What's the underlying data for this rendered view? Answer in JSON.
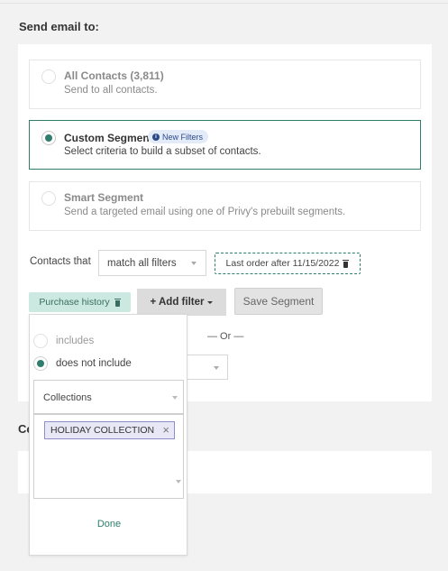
{
  "heading": "Send email to:",
  "options": [
    {
      "title": "All Contacts (3,811)",
      "description": "Send to all contacts.",
      "selected": false
    },
    {
      "title": "Custom Segment",
      "description": "Select criteria to build a subset of contacts.",
      "selected": true,
      "badge": "New Filters"
    },
    {
      "title": "Smart Segment",
      "description": "Send a targeted email using one of Privy's prebuilt segments.",
      "selected": false
    }
  ],
  "filters": {
    "contacts_that_label": "Contacts that",
    "match_select": "match all filters",
    "active_filter_chip": "Last order after 11/15/2022",
    "purchase_history_chip": "Purchase history",
    "add_filter_label": "+ Add filter",
    "save_segment_label": "Save Segment",
    "or_divider": "— Or —"
  },
  "popover": {
    "radio_includes": "includes",
    "radio_does_not_include": "does not include",
    "selected_radio": "does not include",
    "collection_select": "Collections",
    "tags": [
      "HOLIDAY COLLECTION"
    ],
    "done_label": "Done"
  },
  "section2_label": "Co",
  "colors": {
    "accent": "#2f7d6d",
    "chip_bg": "#cbe9e0",
    "badge_bg": "#e3ebf9",
    "tag_border": "#8e8ec8"
  }
}
